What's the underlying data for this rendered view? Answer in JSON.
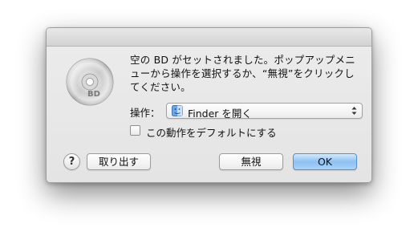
{
  "dialog": {
    "message": "空の BD がセットされました。ポップアップメニューから操作を選択するか、“無視”をクリックしてください。",
    "disc_icon": {
      "name": "bd-disc-icon",
      "label": "BD"
    },
    "action": {
      "label": "操作：",
      "selected": "Finder を開く",
      "icon": "finder-icon"
    },
    "default_checkbox": {
      "label": "この動作をデフォルトにする",
      "checked": false
    },
    "buttons": {
      "help": "?",
      "eject": "取り出す",
      "ignore": "無視",
      "ok": "OK"
    },
    "colors": {
      "default_button": "#8dc1f1",
      "dialog_background": "#e8e8e8"
    }
  }
}
